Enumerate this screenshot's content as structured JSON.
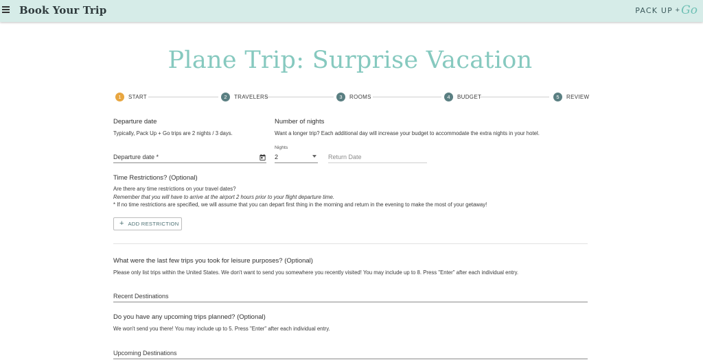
{
  "header": {
    "menu_icon": "hamburger-menu-icon",
    "app_title": "Book Your Trip",
    "brand": {
      "text": "PACK UP",
      "plus": "+",
      "go": "Go"
    },
    "background": "#d6ece8"
  },
  "page_title": "Plane Trip: Surprise Vacation",
  "accent_color": "#86c9bf",
  "stepper": {
    "steps": [
      {
        "number": "1",
        "label": "START",
        "active": true
      },
      {
        "number": "2",
        "label": "TRAVELERS",
        "active": false
      },
      {
        "number": "3",
        "label": "ROOMS",
        "active": false
      },
      {
        "number": "4",
        "label": "BUDGET",
        "active": false
      },
      {
        "number": "5",
        "label": "REVIEW",
        "active": false
      }
    ],
    "active_color": "#e8a640",
    "inactive_color": "#5a7f82"
  },
  "departure": {
    "heading": "Departure date",
    "helper": "Typically, Pack Up + Go trips are 2 nights / 3 days.",
    "field_placeholder": "Departure date *",
    "icon": "calendar-icon"
  },
  "nights": {
    "heading": "Number of nights",
    "helper": "Want a longer trip? Each additional day will increase your budget to accommodate the extra nights in your hotel.",
    "select_label": "Nights",
    "select_value": "2",
    "return_placeholder": "Return Date"
  },
  "time_restrictions": {
    "heading": "Time Restrictions? (Optional)",
    "line1": "Are there any time restrictions on your travel dates?",
    "line2": "Remember that you will have to arrive at the airport 2 hours prior to your flight departure time.",
    "line3": "* If no time restrictions are specified, we will assume that you can depart first thing in the morning and return in the evening to make the most of your getaway!",
    "button_label": "ADD RESTRICTION",
    "button_icon": "plus-icon"
  },
  "recent_trips": {
    "heading": "What were the last few trips you took for leisure purposes? (Optional)",
    "helper": "Please only list trips within the United States. We don't want to send you somewhere you recently visited! You may include up to 8. Press \"Enter\" after each individual entry.",
    "field_placeholder": "Recent Destinations"
  },
  "upcoming_trips": {
    "heading": "Do you have any upcoming trips planned? (Optional)",
    "helper": "We won't send you there! You may include up to 5. Press \"Enter\" after each individual entry.",
    "field_placeholder": "Upcoming Destinations"
  }
}
